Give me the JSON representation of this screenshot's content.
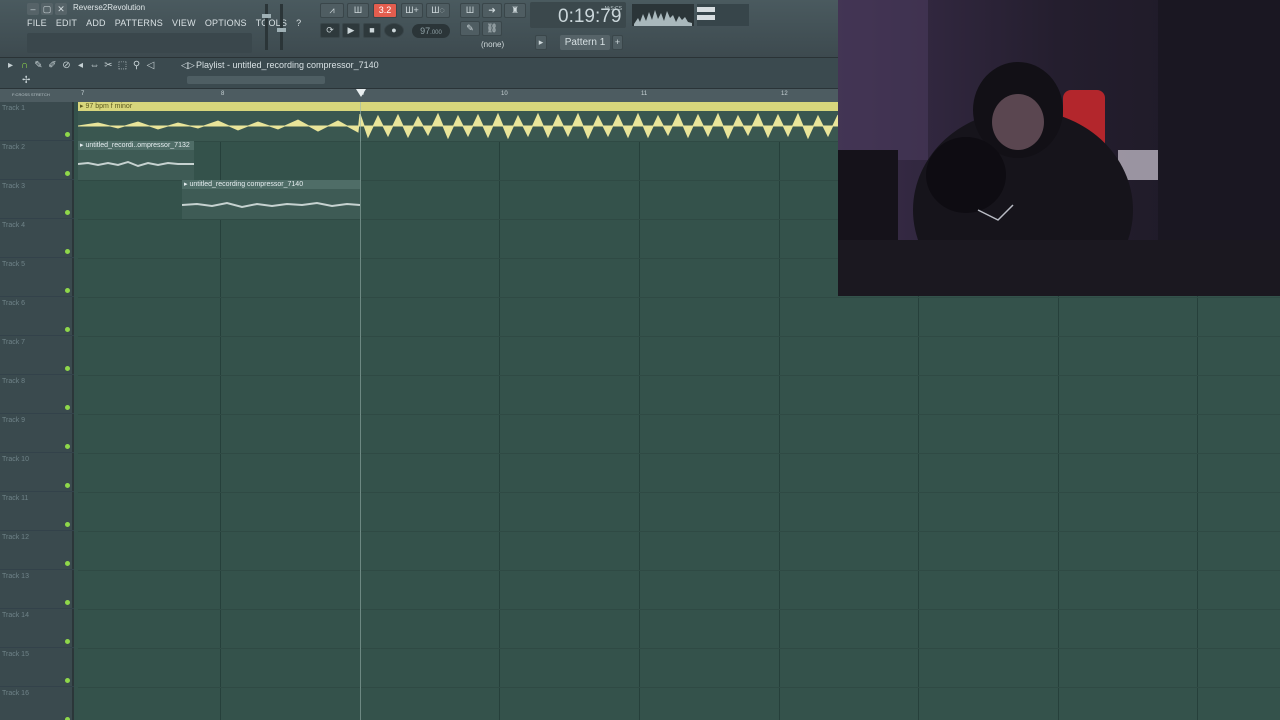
{
  "window": {
    "title": "Reverse2Revolution"
  },
  "menu": [
    "FILE",
    "EDIT",
    "ADD",
    "PATTERNS",
    "VIEW",
    "OPTIONS",
    "TOOLS",
    "?"
  ],
  "transport": {
    "step_display": "3.2",
    "tempo": "97",
    "tempo_unit": ".000",
    "time": "0:19:79",
    "time_unit": "M:S:CS",
    "pattern": "Pattern 1",
    "midi_mode": "(none)"
  },
  "playlist": {
    "title": "Playlist - untitled_recording compressor_7140",
    "ruler_options": "F:CROSS  STRETCH",
    "bars": [
      "7",
      "8",
      "9",
      "10",
      "11",
      "12"
    ],
    "tracks": [
      "Track 1",
      "Track 2",
      "Track 3",
      "Track 4",
      "Track 5",
      "Track 6",
      "Track 7",
      "Track 8",
      "Track 9",
      "Track 10",
      "Track 11",
      "Track 12",
      "Track 13",
      "Track 14",
      "Track 15",
      "Track 16"
    ],
    "clips": [
      {
        "title": "97 bpm f minor"
      },
      {
        "title": "untitled_recordi..ompressor_7132"
      },
      {
        "title": "untitled_recording compressor_7140"
      }
    ]
  },
  "colors": {
    "accent_yellow": "#d8d67c",
    "grid_bg": "#34524b",
    "record_red": "#e35d4e",
    "mute_green": "#8fd84a"
  },
  "icons": [
    "playlist-play-icon",
    "draw-icon",
    "paint-icon",
    "delete-icon",
    "mute-icon",
    "slip-icon",
    "slice-icon",
    "select-icon",
    "zoom-icon",
    "playback-icon"
  ]
}
